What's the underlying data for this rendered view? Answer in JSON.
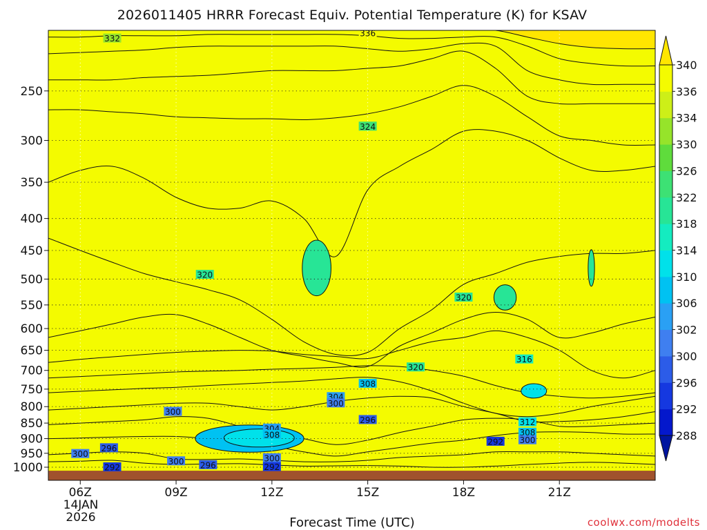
{
  "chart_data": {
    "type": "heatmap",
    "title": "2026011405 HRRR Forecast Equiv. Potential Temperature (K) for KSAV",
    "xlabel": "Forecast Time (UTC)",
    "ylabel": "",
    "credit": "coolwx.com/modelts",
    "date_label": [
      "14JAN",
      "2026"
    ],
    "x_hours": [
      5,
      24
    ],
    "x_ticks": [
      {
        "hour": 6,
        "label": "06Z"
      },
      {
        "hour": 9,
        "label": "09Z"
      },
      {
        "hour": 12,
        "label": "12Z"
      },
      {
        "hour": 15,
        "label": "15Z"
      },
      {
        "hour": 18,
        "label": "18Z"
      },
      {
        "hour": 21,
        "label": "21Z"
      }
    ],
    "y_range_hpa": [
      1013,
      200
    ],
    "y_scale": "log",
    "y_ticks": [
      250,
      300,
      350,
      400,
      450,
      500,
      550,
      600,
      650,
      700,
      750,
      800,
      850,
      900,
      950,
      1000
    ],
    "grid": "dotted",
    "colorbar": {
      "levels": [
        288,
        292,
        296,
        300,
        302,
        306,
        310,
        314,
        318,
        322,
        326,
        330,
        334,
        336,
        340
      ],
      "labels": [
        "288",
        "292",
        "296",
        "300",
        "302",
        "306",
        "310",
        "314",
        "318",
        "322",
        "326",
        "330",
        "334",
        "336",
        "340"
      ],
      "colors": [
        "#0418cc",
        "#1538e0",
        "#2c5ce8",
        "#3f7ff0",
        "#2aa0f4",
        "#00c2f2",
        "#00e1ea",
        "#14ecc0",
        "#27e596",
        "#3de174",
        "#5fdc3c",
        "#96e42a",
        "#cdef18",
        "#f4fb00"
      ],
      "under_color": "#0015a0",
      "over_color": "#ffe600",
      "extend": "both"
    },
    "ground_color": "#a0522d",
    "bands": [
      {
        "theta": 290,
        "hpa": [
          1008,
          1008,
          1005,
          1000,
          994,
          992,
          994,
          1000,
          1005,
          1004,
          1002,
          1004,
          1006,
          1008,
          1008,
          1008,
          1008,
          1008,
          1008,
          1008
        ]
      },
      {
        "theta": 294,
        "hpa": [
          980,
          978,
          975,
          985,
          990,
          988,
          987,
          992,
          996,
          995,
          994,
          996,
          1000,
          1000,
          996,
          990,
          985,
          982,
          985,
          990
        ]
      },
      {
        "theta": 297,
        "hpa": [
          955,
          950,
          945,
          950,
          970,
          972,
          970,
          975,
          980,
          980,
          975,
          965,
          960,
          955,
          945,
          945,
          945,
          950,
          955,
          960
        ]
      },
      {
        "theta": 299,
        "hpa": [
          900,
          898,
          895,
          893,
          893,
          900,
          910,
          925,
          945,
          960,
          945,
          930,
          915,
          905,
          890,
          880,
          878,
          880,
          885,
          885
        ]
      },
      {
        "theta": 301,
        "hpa": [
          855,
          850,
          845,
          840,
          830,
          835,
          860,
          880,
          900,
          920,
          905,
          880,
          860,
          840,
          835,
          840,
          860,
          860,
          855,
          850
        ]
      },
      {
        "theta": 304,
        "hpa": [
          810,
          805,
          800,
          795,
          790,
          790,
          800,
          810,
          800,
          785,
          775,
          770,
          775,
          800,
          820,
          845,
          845,
          840,
          830,
          815
        ]
      },
      {
        "theta": 308,
        "hpa": [
          760,
          756,
          752,
          748,
          745,
          740,
          736,
          732,
          728,
          722,
          718,
          730,
          755,
          790,
          820,
          830,
          820,
          800,
          785,
          770
        ]
      },
      {
        "theta": 312,
        "hpa": [
          720,
          716,
          712,
          708,
          704,
          702,
          700,
          697,
          695,
          692,
          688,
          690,
          700,
          715,
          740,
          760,
          770,
          775,
          770,
          760
        ]
      },
      {
        "theta": 316,
        "hpa": [
          680,
          672,
          666,
          660,
          655,
          652,
          650,
          652,
          660,
          665,
          670,
          650,
          630,
          620,
          605,
          620,
          650,
          700,
          720,
          700
        ]
      },
      {
        "theta": 319,
        "hpa": [
          620,
          605,
          590,
          575,
          570,
          590,
          620,
          650,
          665,
          680,
          690,
          640,
          610,
          580,
          565,
          580,
          620,
          610,
          590,
          575
        ]
      },
      {
        "theta": 321,
        "hpa": [
          430,
          450,
          470,
          490,
          505,
          520,
          540,
          580,
          630,
          660,
          655,
          600,
          560,
          510,
          490,
          470,
          460,
          455,
          455,
          450
        ]
      },
      {
        "theta": 323,
        "hpa": [
          350,
          335,
          330,
          345,
          370,
          385,
          385,
          375,
          400,
          460,
          360,
          330,
          310,
          290,
          290,
          300,
          320,
          335,
          335,
          330
        ]
      },
      {
        "theta": 326,
        "hpa": [
          268,
          268,
          270,
          272,
          275,
          276,
          277,
          277,
          278,
          276,
          272,
          265,
          255,
          245,
          255,
          275,
          295,
          300,
          305,
          305
        ]
      },
      {
        "theta": 329,
        "hpa": [
          240,
          240,
          240,
          238,
          237,
          236,
          234,
          232,
          232,
          232,
          230,
          228,
          222,
          216,
          230,
          255,
          262,
          262,
          262,
          262
        ]
      },
      {
        "theta": 333,
        "hpa": [
          218,
          217,
          216,
          215,
          213,
          212,
          212,
          212,
          212,
          212,
          214,
          216,
          214,
          210,
          212,
          232,
          240,
          244,
          244,
          244
        ]
      },
      {
        "theta": 336,
        "hpa": [
          205,
          205,
          204,
          204,
          204,
          203,
          203,
          203,
          203,
          203,
          204,
          206,
          206,
          205,
          205,
          212,
          222,
          226,
          228,
          228
        ]
      },
      {
        "theta": 339,
        "hpa": [
          200,
          200,
          200,
          200,
          200,
          200,
          200,
          200,
          200,
          200,
          200,
          200,
          200,
          200,
          200,
          205,
          210,
          213,
          214,
          214
        ]
      }
    ],
    "pockets": [
      {
        "theta": 306,
        "center": {
          "hour": 11.3,
          "hpa": 900
        },
        "span_hours": 3.4,
        "span_hpa": [
          855,
          945
        ]
      },
      {
        "theta": 310,
        "center": {
          "hour": 11.6,
          "hpa": 898
        },
        "span_hours": 2.2,
        "span_hpa": [
          870,
          930
        ]
      },
      {
        "theta": 320,
        "center": {
          "hour": 13.4,
          "hpa": 480
        },
        "span_hours": 0.9,
        "span_hpa": [
          440,
          540
        ]
      },
      {
        "theta": 320,
        "center": {
          "hour": 19.3,
          "hpa": 535
        },
        "span_hours": 0.7,
        "span_hpa": [
          510,
          560
        ]
      },
      {
        "theta": 312,
        "center": {
          "hour": 20.2,
          "hpa": 755
        },
        "span_hours": 0.8,
        "span_hpa": [
          735,
          775
        ]
      },
      {
        "theta": 320,
        "center": {
          "hour": 22.0,
          "hpa": 480
        },
        "span_hours": 0.2,
        "span_hpa": [
          450,
          515
        ]
      }
    ],
    "contour_labels": [
      {
        "text": "332",
        "hour": 7.0,
        "hpa": 206
      },
      {
        "text": "336",
        "hour": 15.0,
        "hpa": 202
      },
      {
        "text": "324",
        "hour": 15.0,
        "hpa": 285
      },
      {
        "text": "320",
        "hour": 9.9,
        "hpa": 492
      },
      {
        "text": "320",
        "hour": 18.0,
        "hpa": 535
      },
      {
        "text": "320",
        "hour": 16.5,
        "hpa": 692
      },
      {
        "text": "316",
        "hour": 19.9,
        "hpa": 672
      },
      {
        "text": "308",
        "hour": 15.0,
        "hpa": 735
      },
      {
        "text": "304",
        "hour": 14.0,
        "hpa": 772
      },
      {
        "text": "300",
        "hour": 14.0,
        "hpa": 790
      },
      {
        "text": "300",
        "hour": 8.9,
        "hpa": 815
      },
      {
        "text": "296",
        "hour": 15.0,
        "hpa": 840
      },
      {
        "text": "304",
        "hour": 12.0,
        "hpa": 867
      },
      {
        "text": "308",
        "hour": 12.0,
        "hpa": 887
      },
      {
        "text": "312",
        "hour": 20.0,
        "hpa": 847
      },
      {
        "text": "308",
        "hour": 20.0,
        "hpa": 880
      },
      {
        "text": "300",
        "hour": 20.0,
        "hpa": 905
      },
      {
        "text": "292",
        "hour": 19.0,
        "hpa": 910
      },
      {
        "text": "296",
        "hour": 6.9,
        "hpa": 932
      },
      {
        "text": "300",
        "hour": 6.0,
        "hpa": 952
      },
      {
        "text": "300",
        "hour": 9.0,
        "hpa": 978
      },
      {
        "text": "300",
        "hour": 12.0,
        "hpa": 967
      },
      {
        "text": "296",
        "hour": 10.0,
        "hpa": 992
      },
      {
        "text": "292",
        "hour": 7.0,
        "hpa": 1000
      },
      {
        "text": "292",
        "hour": 12.0,
        "hpa": 999
      }
    ]
  }
}
